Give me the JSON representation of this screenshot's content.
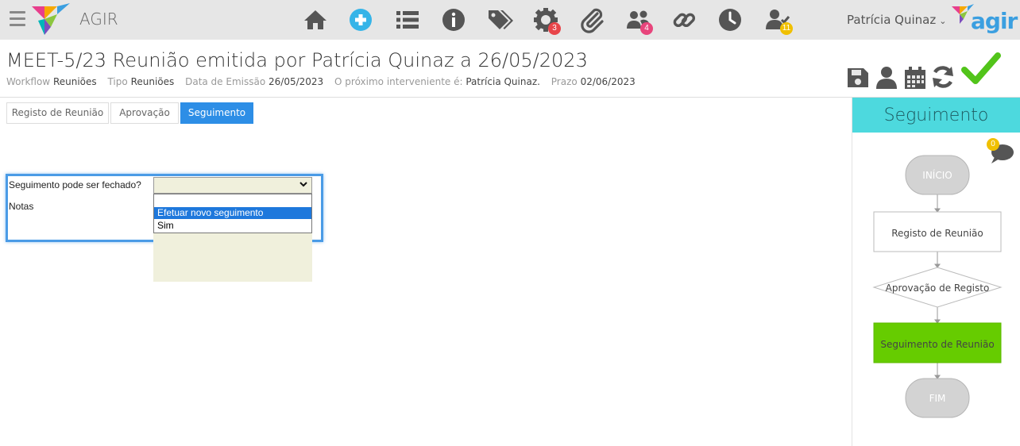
{
  "topbar": {
    "app_name": "AGIR",
    "user_name": "Patrícia Quinaz",
    "user_chevron": "⌄",
    "logo_text": "agir",
    "nav": [
      {
        "icon": "home-icon"
      },
      {
        "icon": "plus-circle-icon"
      },
      {
        "icon": "list-icon"
      },
      {
        "icon": "info-icon"
      },
      {
        "icon": "tags-icon"
      },
      {
        "icon": "gear-icon",
        "badge": "3",
        "badge_color": "#e8454a"
      },
      {
        "icon": "paperclip-icon"
      },
      {
        "icon": "users-icon",
        "badge": "4",
        "badge_color": "#e8457c"
      },
      {
        "icon": "link-icon"
      },
      {
        "icon": "clock-icon"
      },
      {
        "icon": "user-check-icon",
        "badge": "11",
        "badge_color": "#f0c000"
      }
    ]
  },
  "header": {
    "title": "MEET-5/23 Reunião emitida por Patrícia Quinaz a 26/05/2023",
    "meta": {
      "workflow_label": "Workflow",
      "workflow_value": "Reuniões",
      "tipo_label": "Tipo",
      "tipo_value": "Reuniões",
      "data_label": "Data de Emissão",
      "data_value": "26/05/2023",
      "next_label": "O próximo interveniente é:",
      "next_value": "Patrícia Quinaz.",
      "prazo_label": "Prazo",
      "prazo_value": "02/06/2023"
    },
    "actions": [
      "save-icon",
      "user-icon",
      "calendar-icon",
      "refresh-icon",
      "checkmark-icon"
    ]
  },
  "tabs": [
    {
      "label": "Registo de Reunião",
      "active": false
    },
    {
      "label": "Aprovação",
      "active": false
    },
    {
      "label": "Seguimento",
      "active": true
    }
  ],
  "form": {
    "question_label": "Seguimento pode ser fechado?",
    "notes_label": "Notas",
    "select_value": "",
    "options": [
      "",
      "Efetuar novo seguimento",
      "Sim"
    ],
    "highlighted_option": "Efetuar novo seguimento"
  },
  "right_panel": {
    "title": "Seguimento",
    "comments_count": "0",
    "flow": {
      "start": "INÍCIO",
      "steps": [
        "Registo de Reunião",
        "Aprovação de Registo",
        "Seguimento de Reunião"
      ],
      "end": "FIM",
      "active_color": "#66cc00"
    }
  }
}
